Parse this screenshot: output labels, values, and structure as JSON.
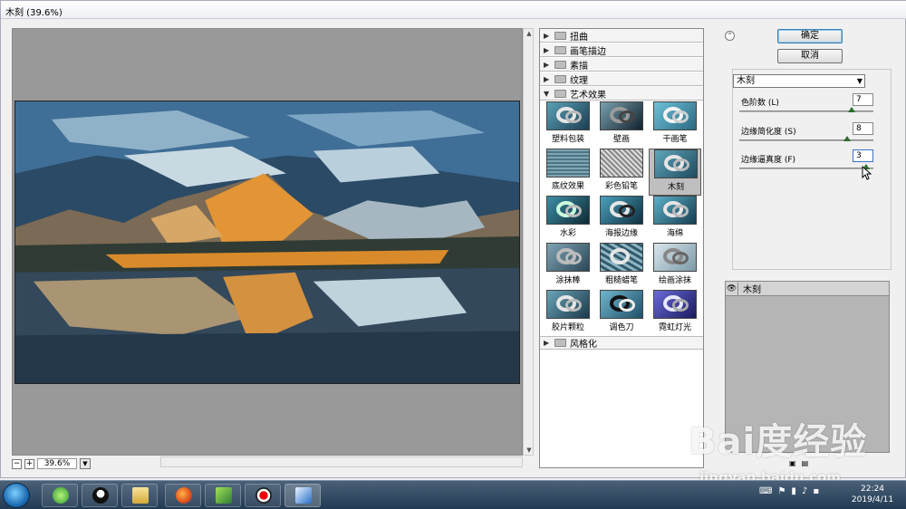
{
  "window": {
    "title": "木刻 (39.6%)"
  },
  "preview": {
    "zoom": "39.6%",
    "zoom_minus": "−",
    "zoom_plus": "+"
  },
  "gallery": {
    "categories": [
      {
        "label": "扭曲",
        "expanded": false
      },
      {
        "label": "画笔描边",
        "expanded": false
      },
      {
        "label": "素描",
        "expanded": false
      },
      {
        "label": "纹理",
        "expanded": false
      },
      {
        "label": "艺术效果",
        "expanded": true
      },
      {
        "label": "风格化",
        "expanded": false
      }
    ],
    "filters": [
      "塑料包装",
      "壁画",
      "干画笔",
      "底纹效果",
      "彩色铅笔",
      "木刻",
      "水彩",
      "海报边缘",
      "海绵",
      "涂抹棒",
      "粗糙蜡笔",
      "绘画涂抹",
      "胶片颗粒",
      "调色刀",
      "霓虹灯光"
    ],
    "selected": "木刻"
  },
  "panel": {
    "ok_label": "确定",
    "cancel_label": "取消",
    "filter_select": "木刻",
    "params": [
      {
        "label": "色阶数 (L)",
        "value": "7",
        "level": 0.83
      },
      {
        "label": "边缘简化度 (S)",
        "value": "8",
        "level": 0.8
      },
      {
        "label": "边缘逼真度 (F)",
        "value": "3",
        "level": 0.96
      }
    ],
    "layer_name": "木刻"
  },
  "taskbar": {
    "time": "22:24",
    "date": "2019/4/11"
  },
  "watermark": {
    "brand": "Bai度经验",
    "url": "jingyan.baidu.com"
  },
  "colors": {
    "accent": "#3c7fb1",
    "preview_bg": "#999999",
    "taskbar": "#223a52"
  }
}
